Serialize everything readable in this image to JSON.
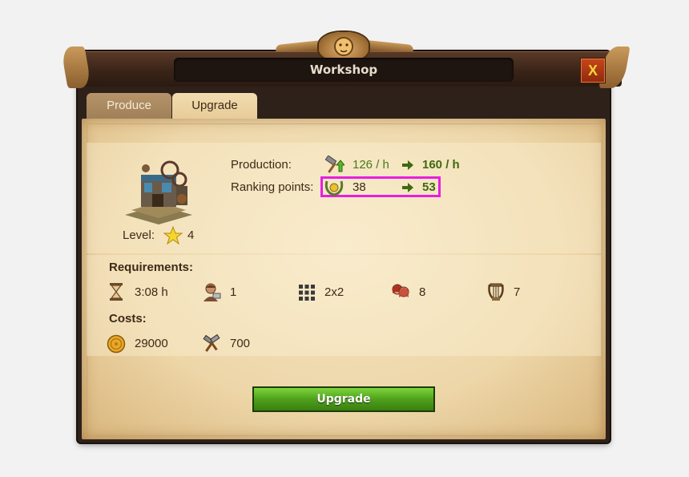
{
  "window": {
    "title": "Workshop",
    "close_label": "X"
  },
  "tabs": [
    {
      "label": "Produce"
    },
    {
      "label": "Upgrade"
    }
  ],
  "production": {
    "label": "Production:",
    "current": "126 / h",
    "next": "160 / h",
    "icon": "hammer-icon"
  },
  "ranking": {
    "label": "Ranking points:",
    "current": "38",
    "next": "53",
    "icon": "laurel-icon"
  },
  "level": {
    "label": "Level:",
    "value": "4",
    "icon": "star-icon"
  },
  "requirements": {
    "heading": "Requirements:",
    "items": [
      {
        "icon": "hourglass-icon",
        "value": "3:08 h"
      },
      {
        "icon": "worker-icon",
        "value": "1"
      },
      {
        "icon": "grid-size-icon",
        "value": "2x2"
      },
      {
        "icon": "population-icon",
        "value": "8"
      },
      {
        "icon": "lyre-icon",
        "value": "7"
      }
    ]
  },
  "costs": {
    "heading": "Costs:",
    "items": [
      {
        "icon": "coin-icon",
        "value": "29000"
      },
      {
        "icon": "supplies-icon",
        "value": "700"
      }
    ]
  },
  "upgrade_button": {
    "label": "Upgrade"
  },
  "colors": {
    "accent_green": "#3d6a10",
    "highlight": "#e81ee0",
    "parchment": "#f6e6c4"
  }
}
